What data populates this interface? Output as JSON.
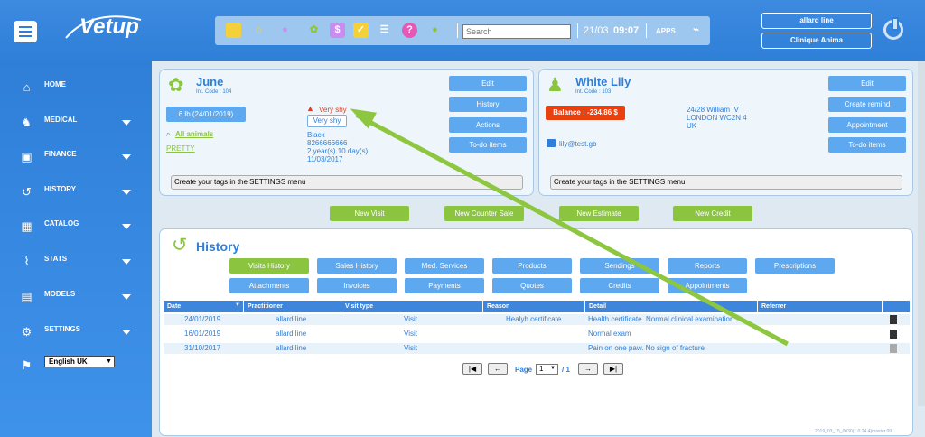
{
  "topbar": {
    "logo": "Vetup",
    "search_placeholder": "Search",
    "date": "21/03",
    "time": "09:07",
    "apps": "APPS",
    "user_name": "allard line",
    "clinic": "Clinique Anima"
  },
  "sidebar": {
    "items": [
      {
        "label": "HOME",
        "icon": "home-icon"
      },
      {
        "label": "MEDICAL",
        "icon": "medical-icon"
      },
      {
        "label": "FINANCE",
        "icon": "finance-icon"
      },
      {
        "label": "HISTORY",
        "icon": "history-icon"
      },
      {
        "label": "CATALOG",
        "icon": "catalog-icon"
      },
      {
        "label": "STATS",
        "icon": "stats-icon"
      },
      {
        "label": "MODELS",
        "icon": "models-icon"
      },
      {
        "label": "SETTINGS",
        "icon": "settings-icon"
      }
    ],
    "language": "English UK"
  },
  "patient": {
    "name": "June",
    "code": "Int. Code : 104",
    "weight": "6 lb (24/01/2019)",
    "all_animals": "All animals",
    "tag": "PRETTY",
    "warning": "Very shy",
    "warning_button": "Very shy",
    "color": "Black",
    "chip": "8266666666",
    "age": "2 year(s) 10 day(s)",
    "birth": "11/03/2017",
    "tag_message": "Create your tags in the SETTINGS menu",
    "buttons": [
      "Edit",
      "History",
      "Actions",
      "To-do items"
    ]
  },
  "owner": {
    "name": "White Lily",
    "code": "Int. Code : 103",
    "balance": "Balance : -234.86 $",
    "address1": "24/28 William IV",
    "address2": "LONDON WC2N 4",
    "country": "UK",
    "email": "lily@test.gb",
    "tag_message": "Create your tags in the SETTINGS menu",
    "buttons": [
      "Edit",
      "Create remind",
      "Appointment",
      "To-do items"
    ]
  },
  "actions": [
    "New Visit",
    "New Counter Sale",
    "New Estimate",
    "New Credit"
  ],
  "history": {
    "title": "History",
    "tabs_row1": [
      "Visits History",
      "Sales History",
      "Med. Services",
      "Products",
      "Sendings",
      "Reports",
      "Prescriptions"
    ],
    "tabs_row2": [
      "Attachments",
      "Invoices",
      "Payments",
      "Quotes",
      "Credits",
      "Appointments"
    ],
    "columns": [
      "Date",
      "Practitioner",
      "Visit type",
      "Reason",
      "Detail",
      "Referrer"
    ],
    "rows": [
      [
        "24/01/2019",
        "allard line",
        "Visit",
        "Healyh certificate",
        "Health certificate. Normal clinical examination",
        ""
      ],
      [
        "16/01/2019",
        "allard line",
        "Visit",
        "",
        "Normal exam",
        ""
      ],
      [
        "31/10/2017",
        "allard line",
        "Visit",
        "",
        "Pain on one paw. No sign of fracture",
        ""
      ]
    ],
    "page_label": "Page",
    "page": "1",
    "page_total": "/ 1"
  },
  "footer": {
    "version": "2019_03_15_0030(1.0.24.4)master.09"
  }
}
